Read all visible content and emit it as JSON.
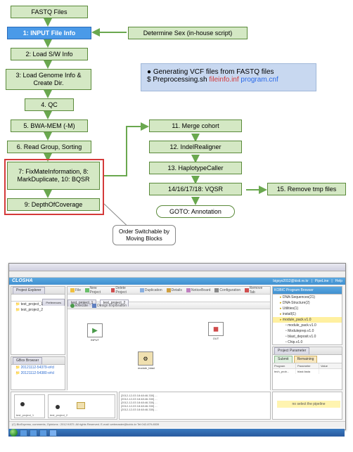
{
  "flow": {
    "fastq": "FASTQ Files",
    "step1": "1: INPUT File Info",
    "determine_sex": "Determine Sex (in-house script)",
    "step2": "2: Load S/W Info",
    "step3": "3: Load Genome Info & Create Dir.",
    "step4": "4. QC",
    "step5": "5. BWA-MEM (-M)",
    "step6": "6. Read Group, Sorting",
    "step7_8_10": "7: FixMateInformation, 8: MarkDuplicate, 10: BQSR",
    "step9": "9: DepthOfCoverage",
    "callout": "Order Switchable by Moving Blocks",
    "info_line1": "● Generating VCF files from FASTQ files",
    "info_line2_cmd": "$ Preprocessing.sh ",
    "info_line2_red": "fileinfo.inf ",
    "info_line2_blue": "program.cnf",
    "step11": "11. Merge cohort",
    "step12": "12. IndelRealigner",
    "step13": "13. HaplotypeCaller",
    "step14": "14/16/17/18:  VQSR",
    "step15": "15. Remove tmp files",
    "goto": "GOTO: Annotation"
  },
  "closha": {
    "brand": "CLOSHA",
    "user": "bigsys2012@kisti.re.kr",
    "menu_pipeline": "PipeLine",
    "menu_help": "Help",
    "project_explorer": "Project Explorer",
    "preferences": "Preferences",
    "folder1": "test_project_1",
    "folder2": "test_project_2",
    "gbox_tab": "GBox Browser",
    "gbox_dir1": "20121112-54379-x#cl",
    "gbox_dir2": "20121112-54380-x#cl",
    "toolbar": {
      "file": "File",
      "new_project": "New Project",
      "delete_project": "Delete Project",
      "duplication": "Duplication",
      "details": "Details",
      "noticeboard": "NoticeBoard",
      "configuration": "Configuration",
      "remove_tab": "Remove Tab"
    },
    "tab1": "test_project_1",
    "tab2": "test_project_2",
    "sub_toolbar": {
      "execute": "Execute",
      "design_exploration": "Design Exploration"
    },
    "canvas": {
      "input": "INPUT",
      "out": "OUT",
      "module": "module_blast"
    },
    "right_panel": {
      "title": "KOBIC Program Browser",
      "cat1": "DNA-Sequences(21)",
      "cat2": "DNA-Structure(2)",
      "cat3": "Utilities(1)",
      "cat4": "install(1)",
      "module_root": "module_pack.v1.0",
      "m1": "module_pack.v1.0",
      "m2": "Moduleprep.v1.0",
      "m3": "blast_deposit.v1.0",
      "m4": "Chip.v1.0",
      "param_title": "Project Parameter",
      "btn_submit": "Submit",
      "btn_remove": "Remaining",
      "col_program": "Program",
      "col_param": "Parameter",
      "col_val": "Value",
      "row_prog": "tech_prob...",
      "row_param": "blast.fasta"
    },
    "bottom": {
      "thumb1": "test_project_1",
      "thumb2": "test_project_2",
      "log1": "[2012-12-03 18:48:46.330]  ...",
      "note": "no select the pipeline"
    },
    "statusbar": "(C) BioExpress, comments, Opinions : 2012 KiSTi.  All rights Reserved.  E-mail: webmaster@kobic.kr  Tel:042-879-8539"
  }
}
